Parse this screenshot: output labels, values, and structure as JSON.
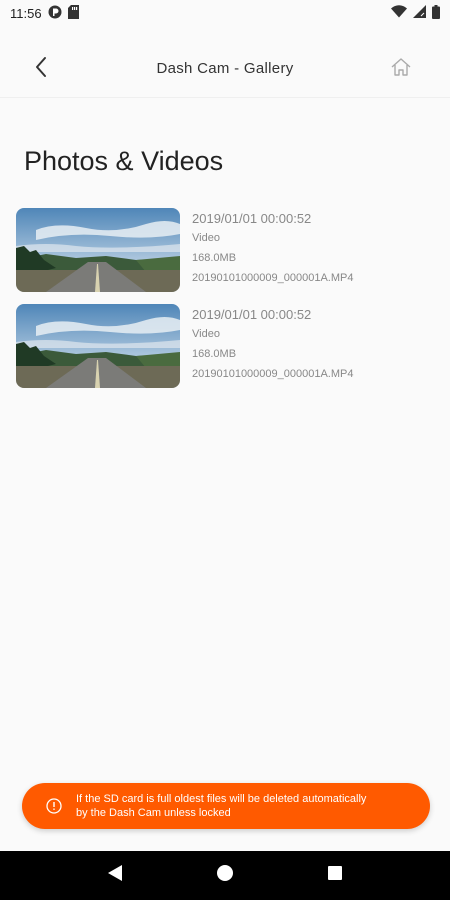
{
  "status_bar": {
    "time": "11:56",
    "left_icons": [
      "pocket-casts-icon",
      "sd-card-icon"
    ],
    "right_icons": [
      "wifi-icon",
      "signal-icon",
      "battery-icon"
    ]
  },
  "app_bar": {
    "title": "Dash Cam - Gallery",
    "back_icon": "chevron-left-icon",
    "home_icon": "home-icon"
  },
  "heading": "Photos & Videos",
  "media_items": [
    {
      "date": "2019/01/01 00:00:52",
      "type": "Video",
      "size": "168.0MB",
      "filename": "20190101000009_000001A.MP4"
    },
    {
      "date": "2019/01/01 00:00:52",
      "type": "Video",
      "size": "168.0MB",
      "filename": "20190101000009_000001A.MP4"
    }
  ],
  "toast": {
    "icon": "info-icon",
    "message": "If the SD card is full oldest files will be deleted automatically by the Dash Cam unless locked",
    "background": "#ff5a00"
  },
  "nav_bar": {
    "buttons": [
      "back-triangle-icon",
      "home-circle-icon",
      "recents-square-icon"
    ]
  }
}
